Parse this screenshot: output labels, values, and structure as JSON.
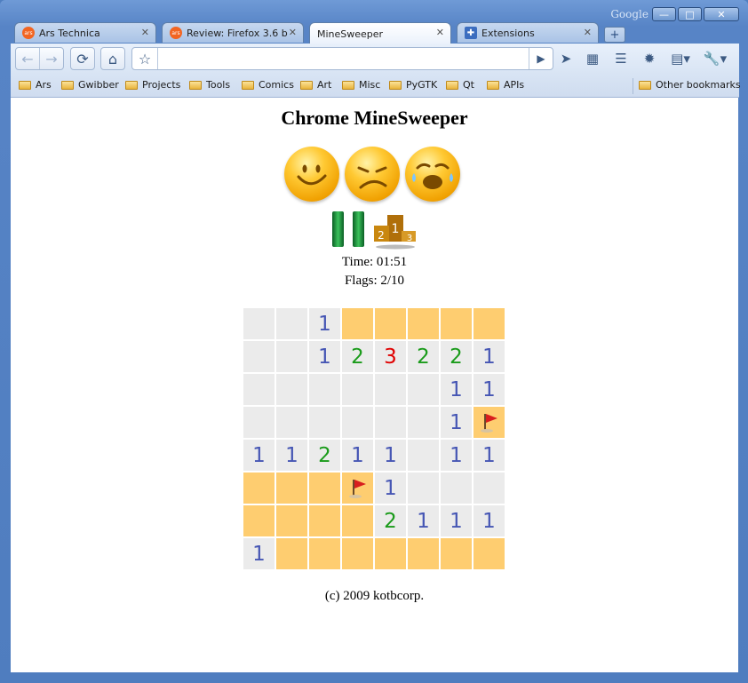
{
  "window": {
    "brand": "Google",
    "controls": [
      "minimize",
      "maximize",
      "close"
    ]
  },
  "tabs": [
    {
      "label": "Ars Technica",
      "favicon": "ars",
      "active": false
    },
    {
      "label": "Review: Firefox 3.6 b",
      "favicon": "ars",
      "active": false
    },
    {
      "label": "MineSweeper",
      "favicon": "",
      "active": true
    },
    {
      "label": "Extensions",
      "favicon": "puzzle",
      "active": false
    }
  ],
  "toolbar": {
    "address_value": "",
    "icons": [
      "back-icon",
      "forward-icon",
      "reload-icon",
      "home-icon",
      "star-icon",
      "go-icon",
      "bird-icon",
      "extension-icon",
      "list-icon",
      "gear-icon",
      "page-menu-icon",
      "wrench-menu-icon"
    ]
  },
  "bookmarks": {
    "items": [
      "Ars",
      "Gwibber",
      "Projects",
      "Tools",
      "Comics",
      "Art",
      "Misc",
      "PyGTK",
      "Qt",
      "APIs"
    ],
    "other": "Other bookmarks"
  },
  "game": {
    "title": "Chrome MineSweeper",
    "faces": [
      "smile-face-icon",
      "sad-face-icon",
      "crying-face-icon"
    ],
    "time_label": "Time: 01:51",
    "flags_label": "Flags: 2/10",
    "copyright": "(c) 2009 kotbcorp.",
    "colors": {
      "closed": "#fecd70",
      "open": "#ebebeb",
      "one": "#4656b4",
      "two": "#1a9b1a",
      "three": "#e00000"
    },
    "board": [
      [
        "o",
        "o",
        "1",
        "c",
        "c",
        "c",
        "c",
        "c"
      ],
      [
        "o",
        "o",
        "1",
        "2",
        "3",
        "2",
        "2",
        "1"
      ],
      [
        "o",
        "o",
        "o",
        "o",
        "o",
        "o",
        "1",
        "1"
      ],
      [
        "o",
        "o",
        "o",
        "o",
        "o",
        "o",
        "1",
        "f"
      ],
      [
        "1",
        "1",
        "2",
        "1",
        "1",
        "o",
        "1",
        "1"
      ],
      [
        "c",
        "c",
        "c",
        "f",
        "1",
        "o",
        "o",
        "o"
      ],
      [
        "c",
        "c",
        "c",
        "c",
        "2",
        "1",
        "1",
        "1"
      ],
      [
        "1",
        "c",
        "c",
        "c",
        "c",
        "c",
        "c",
        "c"
      ]
    ]
  }
}
